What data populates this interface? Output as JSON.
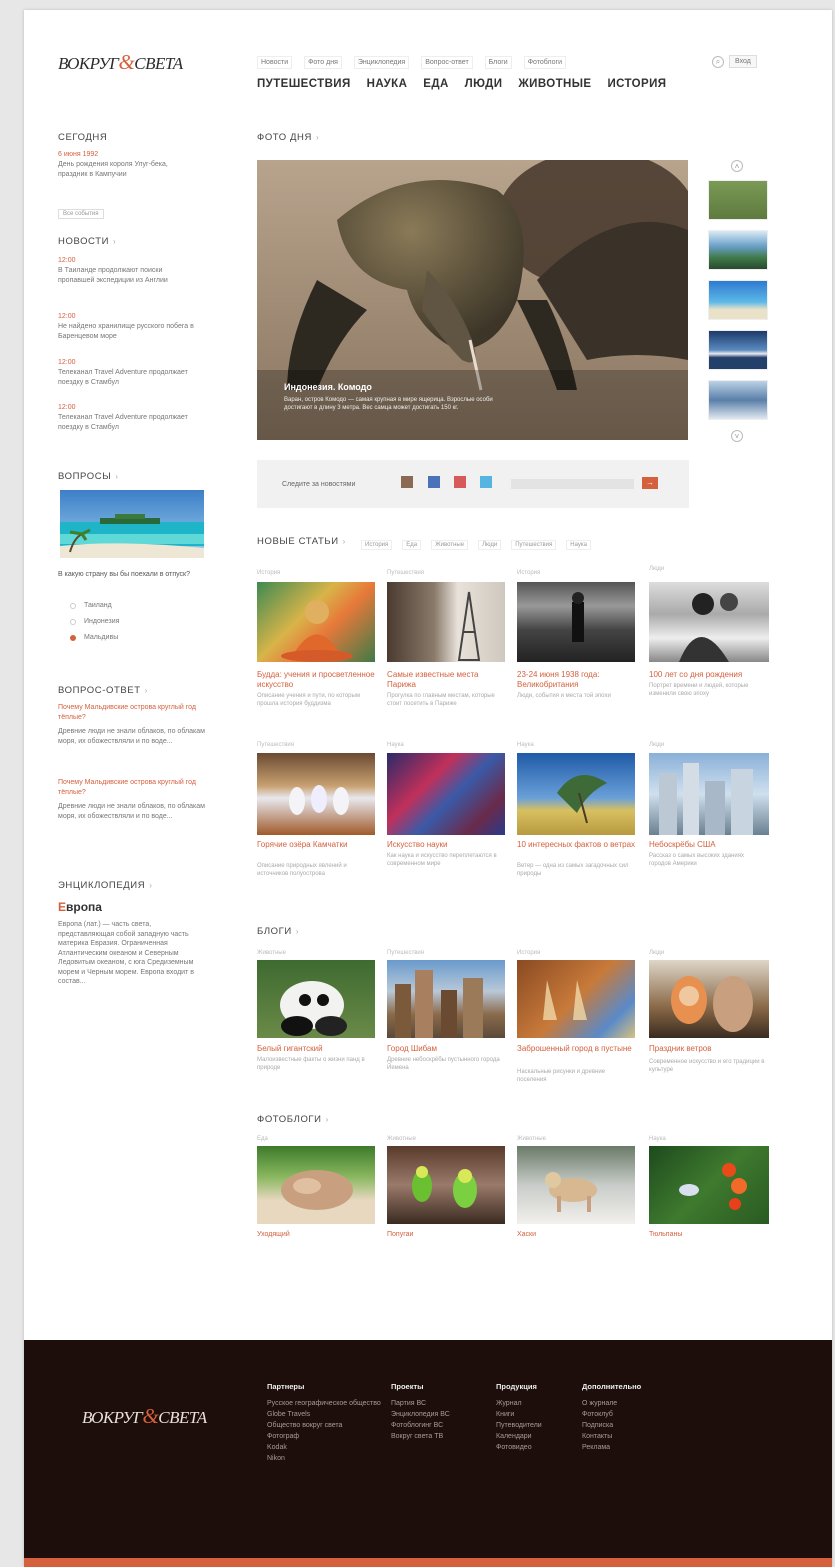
{
  "header": {
    "logo_left": "ВОКРУГ",
    "logo_amp": "&",
    "logo_right": "СВЕТА",
    "top_links": [
      "Новости",
      "Фото дня",
      "Энциклопедия",
      "Вопрос-ответ",
      "Блоги",
      "Фотоблоги"
    ],
    "main_nav": [
      "ПУТЕШЕСТВИЯ",
      "НАУКА",
      "ЕДА",
      "ЛЮДИ",
      "ЖИВОТНЫЕ",
      "ИСТОРИЯ"
    ],
    "login": "Вход"
  },
  "sidebar": {
    "today": {
      "title": "СЕГОДНЯ",
      "date": "6 июня 1992",
      "text": "День рождения короля Улуг-бека, праздник в Кампучии",
      "button": "Все события"
    },
    "news": {
      "title": "НОВОСТИ",
      "items": [
        {
          "time": "12:00",
          "text": "В Таиланде продолжают поиски пропавшей экспедиции из Англии"
        },
        {
          "time": "12:00",
          "text": "Не найдено хранилище русского побега в Баренцевом море"
        },
        {
          "time": "12:00",
          "text": "Телеканал Travel Adventure продолжает поездку в Стамбул"
        },
        {
          "time": "12:00",
          "text": "Телеканал Travel Adventure продолжает поездку в Стамбул"
        }
      ]
    },
    "questions": {
      "title": "ВОПРОСЫ",
      "question": "В какую страну вы бы поехали в отпуск?",
      "options": [
        "Таиланд",
        "Индонезия",
        "Мальдивы"
      ],
      "selected": 2
    },
    "qa": {
      "title": "ВОПРОС-ОТВЕТ",
      "items": [
        {
          "q": "Почему Мальдивские острова круглый год тёплые?",
          "a": "Древние люди не знали облаков, по облакам моря, их обожествляли и по воде..."
        },
        {
          "q": "Почему Мальдивские острова круглый год тёплые?",
          "a": "Древние люди не знали облаков, по облакам моря, их обожествляли и по воде..."
        }
      ]
    },
    "encyclopedia": {
      "title": "ЭНЦИКЛОПЕДИЯ",
      "heading_first": "Е",
      "heading_rest": "вропа",
      "text": "Европа (лат.) — часть света, представляющая собой западную часть материка Евразия. Ограниченная Атлантическим океаном и Северным Ледовитым океаном, с юга Средиземным морем и Черным морем. Европа входит в состав..."
    }
  },
  "photo_day": {
    "title": "ФОТО ДНЯ",
    "caption_title": "Индонезия. Комодо",
    "caption_text": "Варан, остров Комодо — самая крупная в мире ящерица. Взрослые особи достигают в длину 3 метра. Вес самца может достигать 150 кг."
  },
  "share": {
    "label": "Следите за новостями",
    "subscribe": "→"
  },
  "new_articles": {
    "title": "НОВЫЕ СТАТЬИ",
    "filters": [
      "История",
      "Еда",
      "Животные",
      "Люди",
      "Путешествия",
      "Наука"
    ],
    "cards": [
      {
        "cat": "История",
        "title": "Будда: учения и просветленное искусство",
        "desc": "Описание учения и пути, по которым прошла история буддизма"
      },
      {
        "cat": "Путешествия",
        "title": "Самые известные места Парижа",
        "desc": "Прогулка по главным местам, которые стоит посетить в Париже"
      },
      {
        "cat": "История",
        "title": "23-24 июня 1938 года: Великобритания",
        "desc": "Люди, события и места той эпохи"
      },
      {
        "cat": "Люди",
        "title": "100 лет со дня рождения",
        "desc": "Портрет времени и людей, которые изменили свою эпоху"
      },
      {
        "cat": "Путешествия",
        "title": "Горячие озёра Камчатки",
        "desc": "Описание природных явлений и источников полуострова"
      },
      {
        "cat": "Наука",
        "title": "Искусство науки",
        "desc": "Как наука и искусство переплетаются в современном мире"
      },
      {
        "cat": "Наука",
        "title": "10 интересных фактов о ветрах",
        "desc": "Ветер — одна из самых загадочных сил природы"
      },
      {
        "cat": "Люди",
        "title": "Небоскрёбы США",
        "desc": "Рассказ о самых высоких зданиях городов Америки"
      }
    ]
  },
  "blogs": {
    "title": "БЛОГИ",
    "cards": [
      {
        "cat": "Животные",
        "title": "Белый гигантский",
        "desc": "Малоизвестные факты о жизни панд в природе"
      },
      {
        "cat": "Путешествия",
        "title": "Город Шибам",
        "desc": "Древние небоскрёбы пустынного города Йемена"
      },
      {
        "cat": "История",
        "title": "Заброшенный город в пустыне",
        "desc": "Наскальные рисунки и древние поселения"
      },
      {
        "cat": "Люди",
        "title": "Праздник ветров",
        "desc": "Современное искусство и его традиции в культуре"
      }
    ]
  },
  "photoblogs": {
    "title": "ФОТОБЛОГИ",
    "cards": [
      {
        "cat": "Еда",
        "title": "Уходящий"
      },
      {
        "cat": "Животные",
        "title": "Попугаи"
      },
      {
        "cat": "Животные",
        "title": "Хаски"
      },
      {
        "cat": "Наука",
        "title": "Тюльпаны"
      }
    ]
  },
  "footer": {
    "columns": [
      {
        "h": "Партнеры",
        "items": [
          "Русское географическое общество",
          "Globe Travels",
          "Общество вокруг света",
          "Фотограф",
          "Kodak",
          "Nikon"
        ]
      },
      {
        "h": "Проекты",
        "items": [
          "Партия ВС",
          "Энциклопедия ВС",
          "Фотоблогинг ВС",
          "Вокруг света ТВ"
        ]
      },
      {
        "h": "Продукция",
        "items": [
          "Журнал",
          "Книги",
          "Путеводители",
          "Календари",
          "Фотовидео"
        ]
      },
      {
        "h": "Дополнительно",
        "items": [
          "О журнале",
          "Фотоклуб",
          "Подписка",
          "Контакты",
          "Реклама"
        ]
      }
    ]
  }
}
